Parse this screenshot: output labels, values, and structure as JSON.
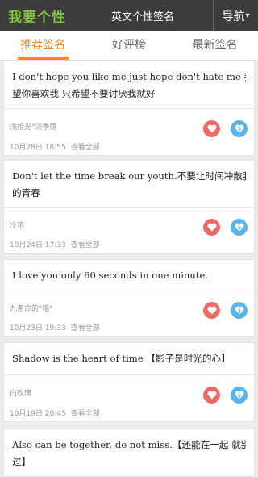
{
  "header": {
    "logo": "我要个性",
    "title": "英文个性签名",
    "nav_label": "导航",
    "nav_arrow": "▾"
  },
  "tabs": [
    {
      "label": "推荐签名",
      "active": true
    },
    {
      "label": "好评榜",
      "active": false
    },
    {
      "label": "最新签名",
      "active": false
    }
  ],
  "view_all_label": "查看全部",
  "posts": [
    {
      "lines": [
        "I don't hope you like me just hope don't hate me 我不奢",
        "望你喜欢我 只希望不要讨厌我就好"
      ],
      "author": "浅拾光°淡季殇",
      "date": "10月28日 18:55"
    },
    {
      "lines": [
        "Don't let the time break our youth.不要让时间冲散我们",
        "的青春"
      ],
      "author": "冷艳",
      "date": "10月24日 17:33"
    },
    {
      "lines": [
        "I love you only 60 seconds in one minute."
      ],
      "author": "九条命的\"喵\"",
      "date": "10月23日 19:33"
    },
    {
      "lines": [
        "Shadow is the heart of time 【影子是时光的心】"
      ],
      "author": "白玫瑰",
      "date": "10月19日 20:45"
    },
    {
      "lines": [
        "Also can be together, do not miss.【还能在一起 就别错",
        "过】"
      ]
    }
  ],
  "colors": {
    "topbar": "#3c3c3c",
    "logo": "#83c440",
    "active_tab": "#f28a20",
    "like": "#ef6b63",
    "dislike": "#59b4ea"
  },
  "icons": {
    "like": "heart-icon",
    "dislike": "broken-heart-icon",
    "nav": "chevron-down-icon"
  }
}
